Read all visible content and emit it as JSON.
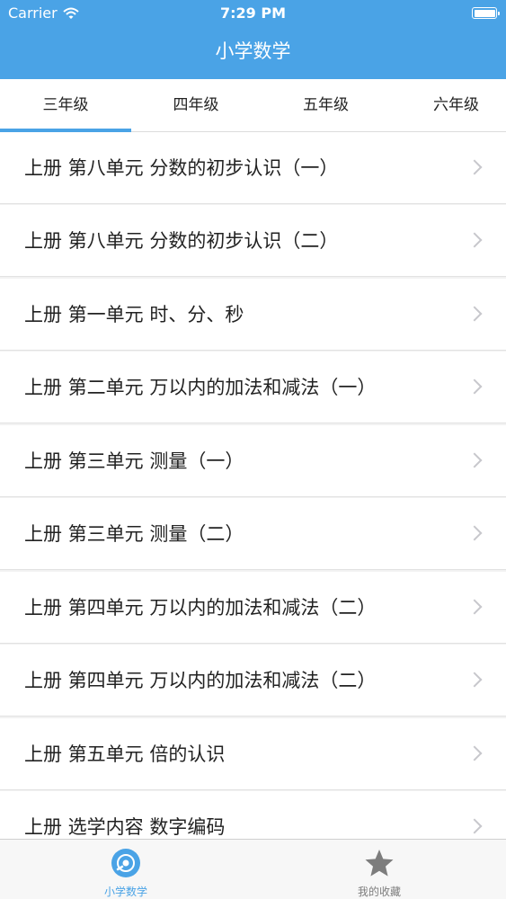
{
  "status_bar": {
    "carrier": "Carrier",
    "time": "7:29 PM"
  },
  "nav": {
    "title": "小学数学"
  },
  "tabs": [
    {
      "label": "三年级",
      "selected": true
    },
    {
      "label": "四年级",
      "selected": false
    },
    {
      "label": "五年级",
      "selected": false
    },
    {
      "label": "六年级",
      "selected": false
    }
  ],
  "list": {
    "items": [
      {
        "label": "上册 第八单元 分数的初步认识（一）"
      },
      {
        "label": "上册 第八单元 分数的初步认识（二）"
      },
      {
        "label": "上册 第一单元 时、分、秒"
      },
      {
        "label": "上册 第二单元 万以内的加法和减法（一）"
      },
      {
        "label": "上册 第三单元 测量（一）"
      },
      {
        "label": "上册 第三单元 测量（二）"
      },
      {
        "label": "上册 第四单元 万以内的加法和减法（二）"
      },
      {
        "label": "上册 第四单元 万以内的加法和减法（二）"
      },
      {
        "label": "上册 第五单元 倍的认识"
      },
      {
        "label": "上册 选学内容 数字编码"
      }
    ]
  },
  "tabbar": {
    "items": [
      {
        "label": "小学数学",
        "icon": "disc-icon",
        "active": true
      },
      {
        "label": "我的收藏",
        "icon": "star-icon",
        "active": false
      }
    ]
  },
  "colors": {
    "accent": "#4aa3e6",
    "inactive": "#7d7d7d"
  }
}
